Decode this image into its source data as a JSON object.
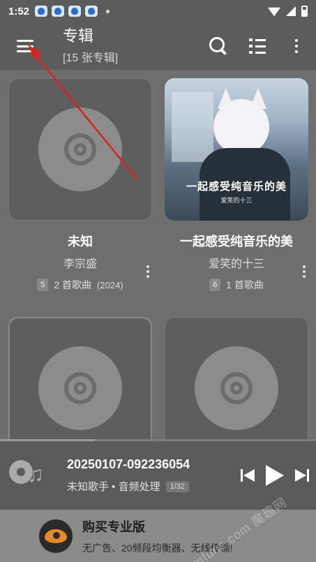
{
  "status_bar": {
    "time": "1:52",
    "icons": [
      "app-icon",
      "paw-icon",
      "paw-icon",
      "paw-icon",
      "notification-dot"
    ],
    "right_icons": [
      "wifi-icon",
      "signal-icon",
      "battery-icon"
    ]
  },
  "toolbar": {
    "title": "专辑",
    "subtitle": "[15 张专辑]",
    "actions": [
      "search-icon",
      "list-icon",
      "more-vert-icon"
    ]
  },
  "albums": [
    {
      "name": "未知",
      "artist": "李宗盛",
      "count_badge": "5",
      "songs": "2 首歌曲",
      "year": "(2024)",
      "cover": "disc-placeholder"
    },
    {
      "name": "一起感受纯音乐的美",
      "artist": "爱笑的十三",
      "count_badge": "6",
      "songs": "1 首歌曲",
      "year": "",
      "cover": "anime-illustration",
      "cover_title": "一起感受纯音乐的美",
      "cover_sub": "爱笑的十三"
    },
    {
      "name": "",
      "artist": "",
      "cover": "disc-placeholder"
    },
    {
      "name": "",
      "artist": "",
      "cover": "disc-placeholder"
    }
  ],
  "player": {
    "track_title": "20250107-092236054",
    "track_sub": "未知歌手 • 音频处理",
    "queue": "1/32",
    "progress": 0.3
  },
  "promo": {
    "title": "购买专业版",
    "description": "无广告、20频段均衡器、无线传输!"
  },
  "watermark": "mfunz.com 魔趣网",
  "colors": {
    "toolbar_bg": "#5c5c5c",
    "page_bg": "#6e6e6e",
    "annotation_arrow": "#e02020"
  }
}
